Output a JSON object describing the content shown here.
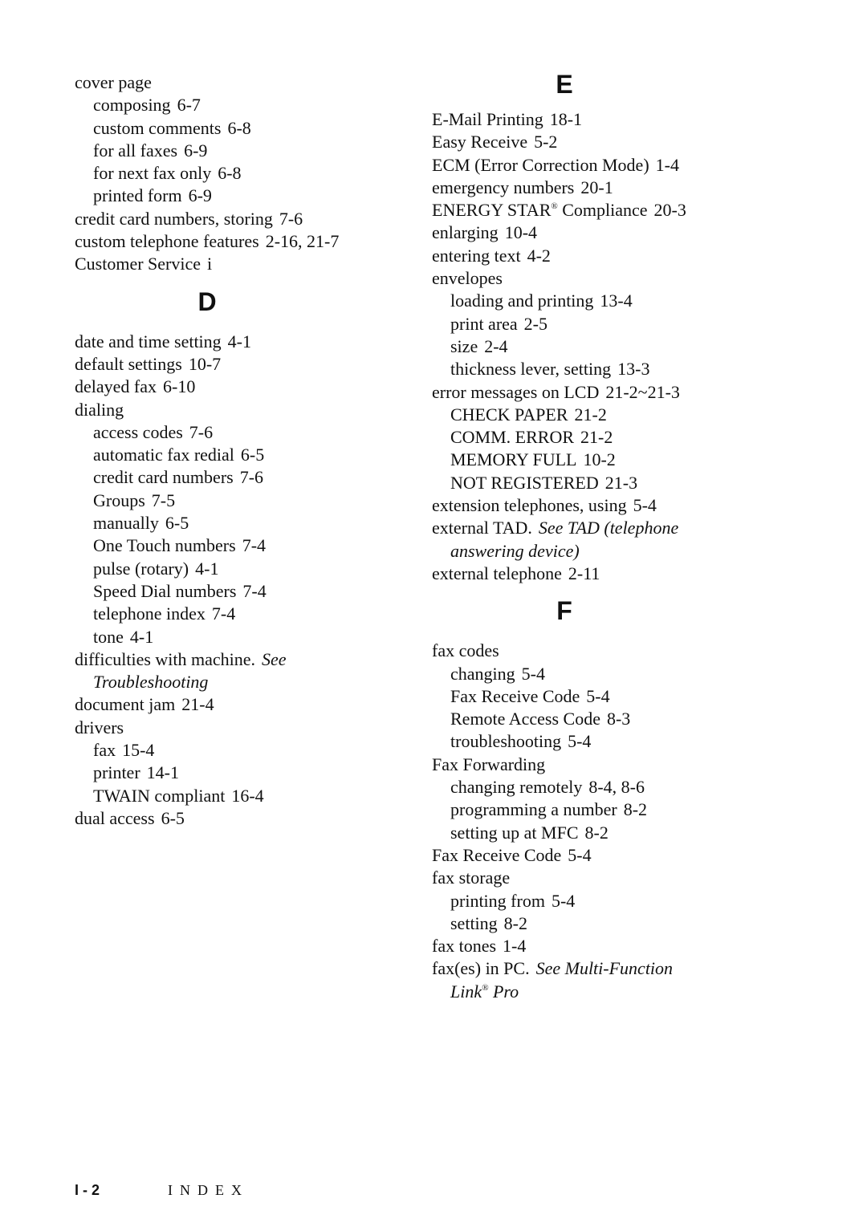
{
  "left_column": {
    "c_tail": [
      {
        "text": "cover page",
        "pages": "",
        "level": 0
      },
      {
        "text": "composing",
        "pages": "6-7",
        "level": 1
      },
      {
        "text": "custom comments",
        "pages": "6-8",
        "level": 1
      },
      {
        "text": "for all faxes",
        "pages": "6-9",
        "level": 1
      },
      {
        "text": "for next fax only",
        "pages": "6-8",
        "level": 1
      },
      {
        "text": "printed form",
        "pages": "6-9",
        "level": 1
      },
      {
        "text": "credit card numbers, storing",
        "pages": "7-6",
        "level": 0
      },
      {
        "text": "custom telephone features",
        "pages": "2-16,  21-7",
        "level": 0
      },
      {
        "text": "Customer Service",
        "pages": "i",
        "level": 0
      }
    ],
    "d_heading": "D",
    "d_entries": [
      {
        "text": "date and time setting",
        "pages": "4-1",
        "level": 0
      },
      {
        "text": "default settings",
        "pages": "10-7",
        "level": 0
      },
      {
        "text": "delayed fax",
        "pages": "6-10",
        "level": 0
      },
      {
        "text": "dialing",
        "pages": "",
        "level": 0
      },
      {
        "text": "access codes",
        "pages": "7-6",
        "level": 1
      },
      {
        "text": "automatic fax redial",
        "pages": "6-5",
        "level": 1
      },
      {
        "text": "credit card numbers",
        "pages": "7-6",
        "level": 1
      },
      {
        "text": "Groups",
        "pages": "7-5",
        "level": 1
      },
      {
        "text": "manually",
        "pages": "6-5",
        "level": 1
      },
      {
        "text": "One Touch numbers",
        "pages": "7-4",
        "level": 1
      },
      {
        "text": "pulse (rotary)",
        "pages": "4-1",
        "level": 1
      },
      {
        "text": "Speed Dial numbers",
        "pages": "7-4",
        "level": 1
      },
      {
        "text": "telephone index",
        "pages": "7-4",
        "level": 1
      },
      {
        "text": "tone",
        "pages": "4-1",
        "level": 1
      }
    ],
    "difficulties": {
      "text": "difficulties with machine.",
      "see": "See",
      "see_target": "Troubleshooting"
    },
    "d_entries_2": [
      {
        "text": "document jam",
        "pages": "21-4",
        "level": 0
      },
      {
        "text": "drivers",
        "pages": "",
        "level": 0
      },
      {
        "text": "fax",
        "pages": "15-4",
        "level": 1
      },
      {
        "text": "printer",
        "pages": "14-1",
        "level": 1
      },
      {
        "text": "TWAIN compliant",
        "pages": "16-4",
        "level": 1
      },
      {
        "text": "dual access",
        "pages": "6-5",
        "level": 0
      }
    ]
  },
  "right_column": {
    "e_heading": "E",
    "e_entries": [
      {
        "text": "E-Mail Printing",
        "pages": "18-1",
        "level": 0
      },
      {
        "text": "Easy Receive",
        "pages": "5-2",
        "level": 0
      },
      {
        "text": "ECM (Error Correction Mode)",
        "pages": "1-4",
        "level": 0
      },
      {
        "text": "emergency numbers",
        "pages": "20-1",
        "level": 0
      }
    ],
    "energy_star": {
      "text": "ENERGY STAR",
      "mark": "®",
      "text_after": "Compliance",
      "pages": "20-3"
    },
    "e_entries_2": [
      {
        "text": "enlarging",
        "pages": "10-4",
        "level": 0
      },
      {
        "text": "entering text",
        "pages": "4-2",
        "level": 0
      },
      {
        "text": "envelopes",
        "pages": "",
        "level": 0
      },
      {
        "text": "loading and printing",
        "pages": "13-4",
        "level": 1
      },
      {
        "text": "print area",
        "pages": "2-5",
        "level": 1
      },
      {
        "text": "size",
        "pages": "2-4",
        "level": 1
      },
      {
        "text": "thickness lever, setting",
        "pages": "13-3",
        "level": 1
      },
      {
        "text": "error messages on LCD",
        "pages": "21-2~21-3",
        "level": 0
      },
      {
        "text": "CHECK PAPER",
        "pages": "21-2",
        "level": 1
      },
      {
        "text": "COMM. ERROR",
        "pages": "21-2",
        "level": 1
      },
      {
        "text": "MEMORY FULL",
        "pages": "10-2",
        "level": 1
      },
      {
        "text": "NOT REGISTERED",
        "pages": "21-3",
        "level": 1
      },
      {
        "text": "extension telephones, using",
        "pages": "5-4",
        "level": 0
      }
    ],
    "external_tad": {
      "text": "external TAD.",
      "see": "See TAD (telephone",
      "see_cont": "answering device)"
    },
    "external_telephone": {
      "text": "external telephone",
      "pages": "2-11"
    },
    "f_heading": "F",
    "f_entries": [
      {
        "text": "fax codes",
        "pages": "",
        "level": 0
      },
      {
        "text": "changing",
        "pages": "5-4",
        "level": 1
      },
      {
        "text": "Fax Receive Code",
        "pages": "5-4",
        "level": 1
      },
      {
        "text": "Remote Access Code",
        "pages": "8-3",
        "level": 1
      },
      {
        "text": "troubleshooting",
        "pages": "5-4",
        "level": 1
      },
      {
        "text": "Fax Forwarding",
        "pages": "",
        "level": 0
      },
      {
        "text": "changing remotely",
        "pages": "8-4,  8-6",
        "level": 1
      },
      {
        "text": "programming a number",
        "pages": "8-2",
        "level": 1
      },
      {
        "text": "setting up at MFC",
        "pages": "8-2",
        "level": 1
      },
      {
        "text": "Fax Receive Code",
        "pages": "5-4",
        "level": 0
      },
      {
        "text": "fax storage",
        "pages": "",
        "level": 0
      },
      {
        "text": "printing from",
        "pages": "5-4",
        "level": 1
      },
      {
        "text": "setting",
        "pages": "8-2",
        "level": 1
      },
      {
        "text": "fax tones",
        "pages": "1-4",
        "level": 0
      }
    ],
    "faxes_in_pc": {
      "text": "fax(es) in PC.",
      "see": "See Multi-Function",
      "see_cont": "Link",
      "see_cont_mark": "®",
      "see_cont_after": "Pro"
    }
  },
  "footer": {
    "page_number": "I - 2",
    "section": "INDEX"
  }
}
